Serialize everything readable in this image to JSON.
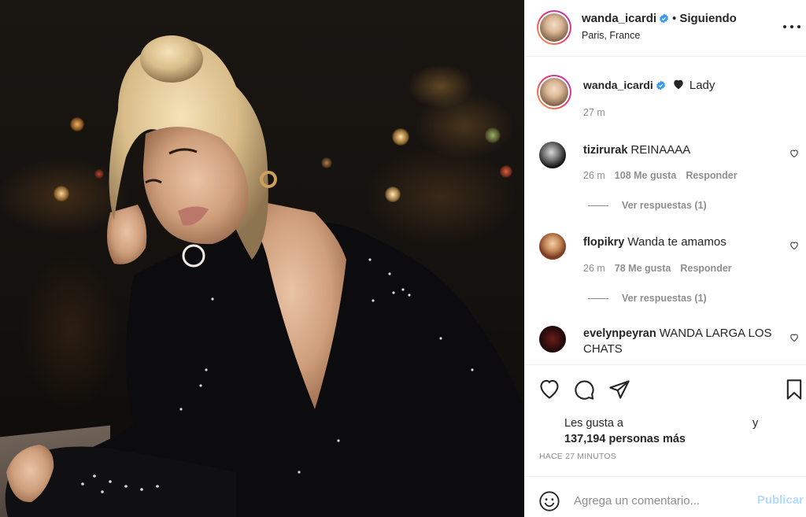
{
  "post_image": {
    "alt": ""
  },
  "header": {
    "username": "wanda_icardi",
    "separator": "•",
    "follow_status": "Siguiendo",
    "location": "Paris, France"
  },
  "caption": {
    "username": "wanda_icardi",
    "text": "Lady",
    "time": "27 m"
  },
  "comments": [
    {
      "username": "tizirurak",
      "text": "REINAAAA",
      "time": "26 m",
      "likes": "108 Me gusta",
      "reply": "Responder",
      "replies": "Ver respuestas (1)"
    },
    {
      "username": "flopikry",
      "text": "Wanda te amamos",
      "time": "26 m",
      "likes": "78 Me gusta",
      "reply": "Responder",
      "replies": "Ver respuestas (1)"
    },
    {
      "username": "evelynpeyran",
      "text": "WANDA LARGA LOS CHATS"
    }
  ],
  "likes": {
    "prefix": "Les gusta a",
    "conjunction": "y",
    "count": "137,194 personas más"
  },
  "timestamp": "HACE 27 MINUTOS",
  "add_comment": {
    "placeholder": "Agrega un comentario...",
    "publish": "Publicar"
  },
  "icons": [
    "verified-badge-icon",
    "more-options-icon",
    "heart-icon",
    "comment-icon",
    "share-icon",
    "bookmark-icon",
    "emoji-icon"
  ],
  "colors": {
    "verified": "#3897f0",
    "publish": "#b3dbff",
    "secondary_text": "#8e8e8e"
  }
}
